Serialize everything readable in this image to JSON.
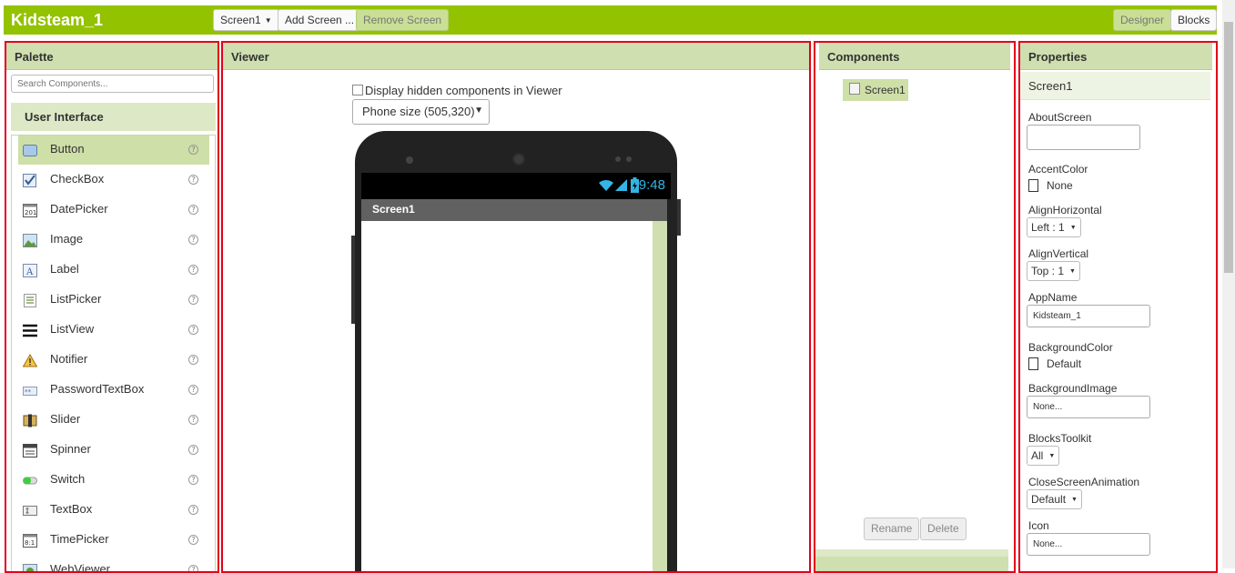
{
  "app": {
    "title": "Kidsteam_1",
    "screen_select": "Screen1",
    "add_screen": "Add Screen ...",
    "remove_screen": "Remove Screen",
    "designer": "Designer",
    "blocks": "Blocks"
  },
  "palette": {
    "title": "Palette",
    "search_placeholder": "Search Components...",
    "category": "User Interface",
    "items": [
      {
        "label": "Button",
        "icon": "button-icon"
      },
      {
        "label": "CheckBox",
        "icon": "checkbox-icon"
      },
      {
        "label": "DatePicker",
        "icon": "datepicker-icon"
      },
      {
        "label": "Image",
        "icon": "image-icon"
      },
      {
        "label": "Label",
        "icon": "label-icon"
      },
      {
        "label": "ListPicker",
        "icon": "listpicker-icon"
      },
      {
        "label": "ListView",
        "icon": "listview-icon"
      },
      {
        "label": "Notifier",
        "icon": "notifier-icon"
      },
      {
        "label": "PasswordTextBox",
        "icon": "password-icon"
      },
      {
        "label": "Slider",
        "icon": "slider-icon"
      },
      {
        "label": "Spinner",
        "icon": "spinner-icon"
      },
      {
        "label": "Switch",
        "icon": "switch-icon"
      },
      {
        "label": "TextBox",
        "icon": "textbox-icon"
      },
      {
        "label": "TimePicker",
        "icon": "timepicker-icon"
      },
      {
        "label": "WebViewer",
        "icon": "webviewer-icon"
      }
    ],
    "help_glyph": "?"
  },
  "viewer": {
    "title": "Viewer",
    "hidden_label": "Display hidden components in Viewer",
    "phone_size": "Phone size (505,320)",
    "time": "9:48",
    "screen_title": "Screen1"
  },
  "components": {
    "title": "Components",
    "root": "Screen1",
    "rename": "Rename",
    "delete": "Delete"
  },
  "properties": {
    "title": "Properties",
    "component": "Screen1",
    "about_screen": "AboutScreen",
    "accent_color": "AccentColor",
    "accent_value": "None",
    "align_horizontal": "AlignHorizontal",
    "align_horizontal_value": "Left : 1",
    "align_vertical": "AlignVertical",
    "align_vertical_value": "Top : 1",
    "app_name": "AppName",
    "app_name_value": "Kidsteam_1",
    "background_color": "BackgroundColor",
    "background_color_value": "Default",
    "background_image": "BackgroundImage",
    "background_image_value": "None...",
    "blocks_toolkit": "BlocksToolkit",
    "blocks_toolkit_value": "All",
    "close_screen_animation": "CloseScreenAnimation",
    "close_screen_animation_value": "Default",
    "icon": "Icon",
    "icon_value": "None..."
  },
  "colors": {
    "accent": "#93c200",
    "panel_header": "#cfdfb0",
    "highlight_border": "#e3001b"
  }
}
